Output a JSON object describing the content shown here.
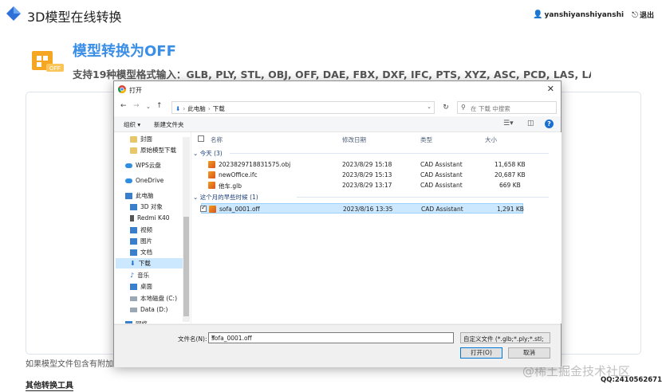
{
  "header": {
    "site_title": "3D模型在线转换",
    "username": "yanshiyanshiyanshi",
    "logout": "退出"
  },
  "hero": {
    "title": "模型转换为OFF",
    "subtitle": "支持19种模型格式输入：GLB, PLY, STL, OBJ, OFF, DAE, FBX, DXF, IFC, PTS, XYZ, ASC, PCD, LAS, LAZ, BREP, S...",
    "icon_badge": "OFF"
  },
  "footer": {
    "note": "如果模型文件包含有附加文件，请将模型文件和附加文件全部选中后，再拖动至上传框",
    "other_tools": "其他转换工具",
    "watermark": "@稀土掘金技术社区",
    "qq": "QQ:2410562671"
  },
  "dialog": {
    "title": "打开",
    "close": "✕",
    "breadcrumb": [
      "此电脑",
      "下载"
    ],
    "search_placeholder": "在 下载 中搜索",
    "organize": "组织 ▾",
    "new_folder": "新建文件夹",
    "nav": [
      {
        "label": "封面",
        "icon": "folder"
      },
      {
        "label": "原始模型下载",
        "icon": "folder"
      },
      {
        "label": "WPS云盘",
        "icon": "cloud"
      },
      {
        "label": "OneDrive",
        "icon": "cloud"
      },
      {
        "label": "此电脑",
        "icon": "pc"
      },
      {
        "label": "3D 对象",
        "icon": "pc"
      },
      {
        "label": "Redmi K40",
        "icon": "phone"
      },
      {
        "label": "视频",
        "icon": "pc"
      },
      {
        "label": "图片",
        "icon": "pc"
      },
      {
        "label": "文档",
        "icon": "pc"
      },
      {
        "label": "下载",
        "icon": "pc"
      },
      {
        "label": "音乐",
        "icon": "pc"
      },
      {
        "label": "桌面",
        "icon": "pc"
      },
      {
        "label": "本地磁盘 (C:)",
        "icon": "drive"
      },
      {
        "label": "Data (D:)",
        "icon": "drive"
      },
      {
        "label": "网络",
        "icon": "pc"
      }
    ],
    "columns": {
      "name": "名称",
      "date": "修改日期",
      "type": "类型",
      "size": "大小"
    },
    "groups": [
      {
        "label": "今天 (3)",
        "files": [
          {
            "name": "2023829718831575.obj",
            "date": "2023/8/29 15:18",
            "type": "CAD Assistant",
            "size": "11,658 KB"
          },
          {
            "name": "newOffice.ifc",
            "date": "2023/8/29 15:13",
            "type": "CAD Assistant",
            "size": "20,687 KB"
          },
          {
            "name": "他车.glb",
            "date": "2023/8/29 13:17",
            "type": "CAD Assistant",
            "size": "669 KB"
          }
        ]
      },
      {
        "label": "这个月的早些时候 (1)",
        "files": [
          {
            "name": "sofa_0001.off",
            "date": "2023/8/16 13:35",
            "type": "CAD Assistant",
            "size": "1,291 KB"
          }
        ]
      }
    ],
    "filename_label": "文件名(N):",
    "filename_value": "sofa_0001.off",
    "filetype": "自定义文件 (*.glb;*.ply;*.stl;*.o",
    "open_button": "打开(O)",
    "cancel_button": "取消"
  },
  "colors": {
    "accent": "#3a8ee6",
    "selection": "#cce8ff",
    "hero_icon": "#f5a623"
  }
}
